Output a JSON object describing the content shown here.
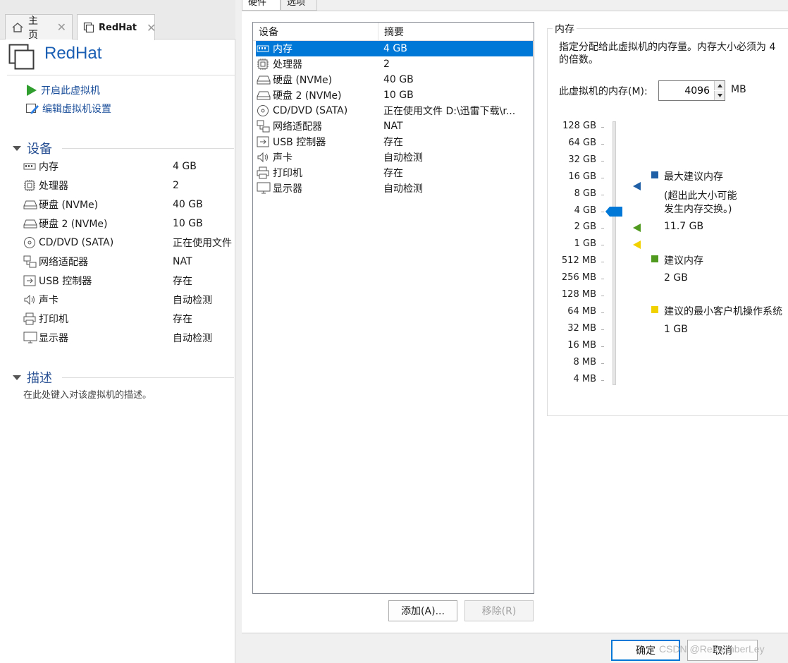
{
  "left_tabs": [
    {
      "label": "主页"
    },
    {
      "label": "RedHat"
    }
  ],
  "vm": {
    "name": "RedHat",
    "actions": [
      {
        "label": "开启此虚拟机",
        "icon": "play-icon"
      },
      {
        "label": "编辑虚拟机设置",
        "icon": "edit-settings-icon"
      }
    ]
  },
  "devices_section": {
    "title": "设备",
    "items": [
      {
        "name": "内存",
        "value": "4 GB",
        "icon": "memory-icon"
      },
      {
        "name": "处理器",
        "value": "2",
        "icon": "cpu-icon"
      },
      {
        "name": "硬盘 (NVMe)",
        "value": "40 GB",
        "icon": "disk-icon"
      },
      {
        "name": "硬盘 2 (NVMe)",
        "value": "10 GB",
        "icon": "disk-icon"
      },
      {
        "name": "CD/DVD (SATA)",
        "value": "正在使用文件",
        "icon": "cd-icon"
      },
      {
        "name": "网络适配器",
        "value": "NAT",
        "icon": "network-icon"
      },
      {
        "name": "USB 控制器",
        "value": "存在",
        "icon": "usb-icon"
      },
      {
        "name": "声卡",
        "value": "自动检测",
        "icon": "speaker-icon"
      },
      {
        "name": "打印机",
        "value": "存在",
        "icon": "printer-icon"
      },
      {
        "name": "显示器",
        "value": "自动检测",
        "icon": "monitor-icon"
      }
    ]
  },
  "description_section": {
    "title": "描述",
    "placeholder": "在此处键入对该虚拟机的描述。"
  },
  "dialog": {
    "tabs": [
      {
        "label": "硬件"
      },
      {
        "label": "选项"
      }
    ],
    "list": {
      "col_device": "设备",
      "col_summary": "摘要",
      "rows": [
        {
          "name": "内存",
          "value": "4 GB",
          "selected": true
        },
        {
          "name": "处理器",
          "value": "2"
        },
        {
          "name": "硬盘 (NVMe)",
          "value": "40 GB"
        },
        {
          "name": "硬盘 2 (NVMe)",
          "value": "10 GB"
        },
        {
          "name": "CD/DVD (SATA)",
          "value": "正在使用文件 D:\\迅雷下载\\r..."
        },
        {
          "name": "网络适配器",
          "value": "NAT"
        },
        {
          "name": "USB 控制器",
          "value": "存在"
        },
        {
          "name": "声卡",
          "value": "自动检测"
        },
        {
          "name": "打印机",
          "value": "存在"
        },
        {
          "name": "显示器",
          "value": "自动检测"
        }
      ]
    },
    "add_button": "添加(A)...",
    "remove_button": "移除(R)",
    "ok_button": "确定",
    "cancel_button": "取消",
    "memory": {
      "group_title": "内存",
      "desc_line1": "指定分配给此虚拟机的内存量。内存大小必须为 4",
      "desc_line2": "的倍数。",
      "field_label": "此虚拟机的内存(M):",
      "value": "4096",
      "unit": "MB",
      "scale": [
        "128 GB",
        "64 GB",
        "32 GB",
        "16 GB",
        "8 GB",
        "4 GB",
        "2 GB",
        "1 GB",
        "512 MB",
        "256 MB",
        "128 MB",
        "64 MB",
        "32 MB",
        "16 MB",
        "8 MB",
        "4 MB"
      ],
      "current_index": 5,
      "markers": {
        "max_recommended_index": 3.5,
        "recommended_index": 6,
        "min_guest_index": 7
      },
      "legend": {
        "max_title": "最大建议内存",
        "max_note_line1": "(超出此大小可能",
        "max_note_line2": "发生内存交换。)",
        "max_value": "11.7 GB",
        "rec_title": "建议内存",
        "rec_value": "2 GB",
        "min_title": "建议的最小客户机操作系统",
        "min_value": "1 GB"
      },
      "colors": {
        "max": "#1f5fa6",
        "recommended": "#4f9a1f",
        "min": "#f2d100",
        "current": "#0078d7"
      }
    }
  },
  "watermark": "CSDN @RememberLey"
}
